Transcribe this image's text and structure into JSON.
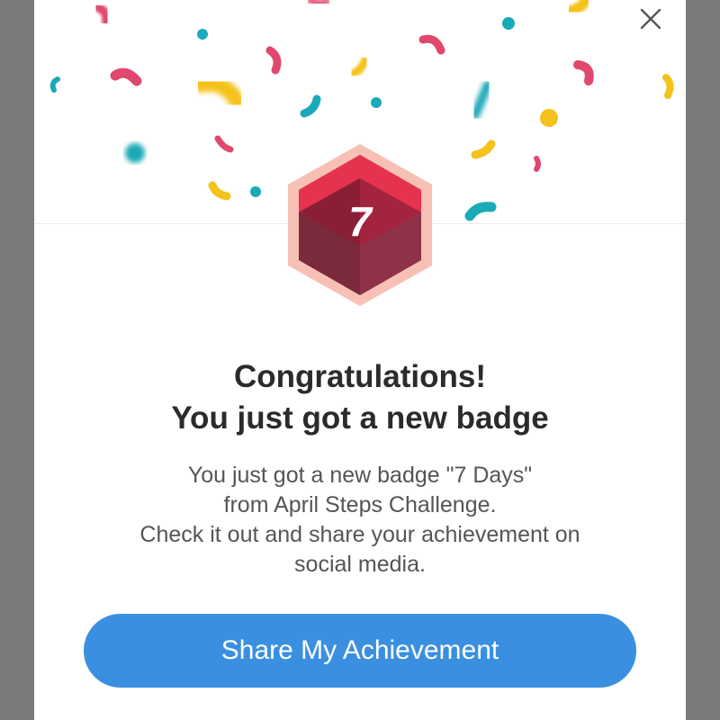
{
  "modal": {
    "close_icon": "close-icon",
    "badge": {
      "number": "7",
      "icon": "hexagon-badge-icon",
      "colors": {
        "outer": "#f6c1b4",
        "top": "#e5334f",
        "dark": "#8a1e35",
        "front": "#7a2a3a"
      }
    },
    "title_line1": "Congratulations!",
    "title_line2": "You just got a new badge",
    "description_lines": [
      "You just got a new badge \"7 Days\"",
      "from April Steps Challenge.",
      "Check it out and share your achievement on",
      "social media."
    ],
    "share_button_label": "Share My Achievement"
  },
  "colors": {
    "accent": "#3a8fe0",
    "confetti": [
      "#e0486e",
      "#1aa9b8",
      "#f5c21b"
    ]
  }
}
